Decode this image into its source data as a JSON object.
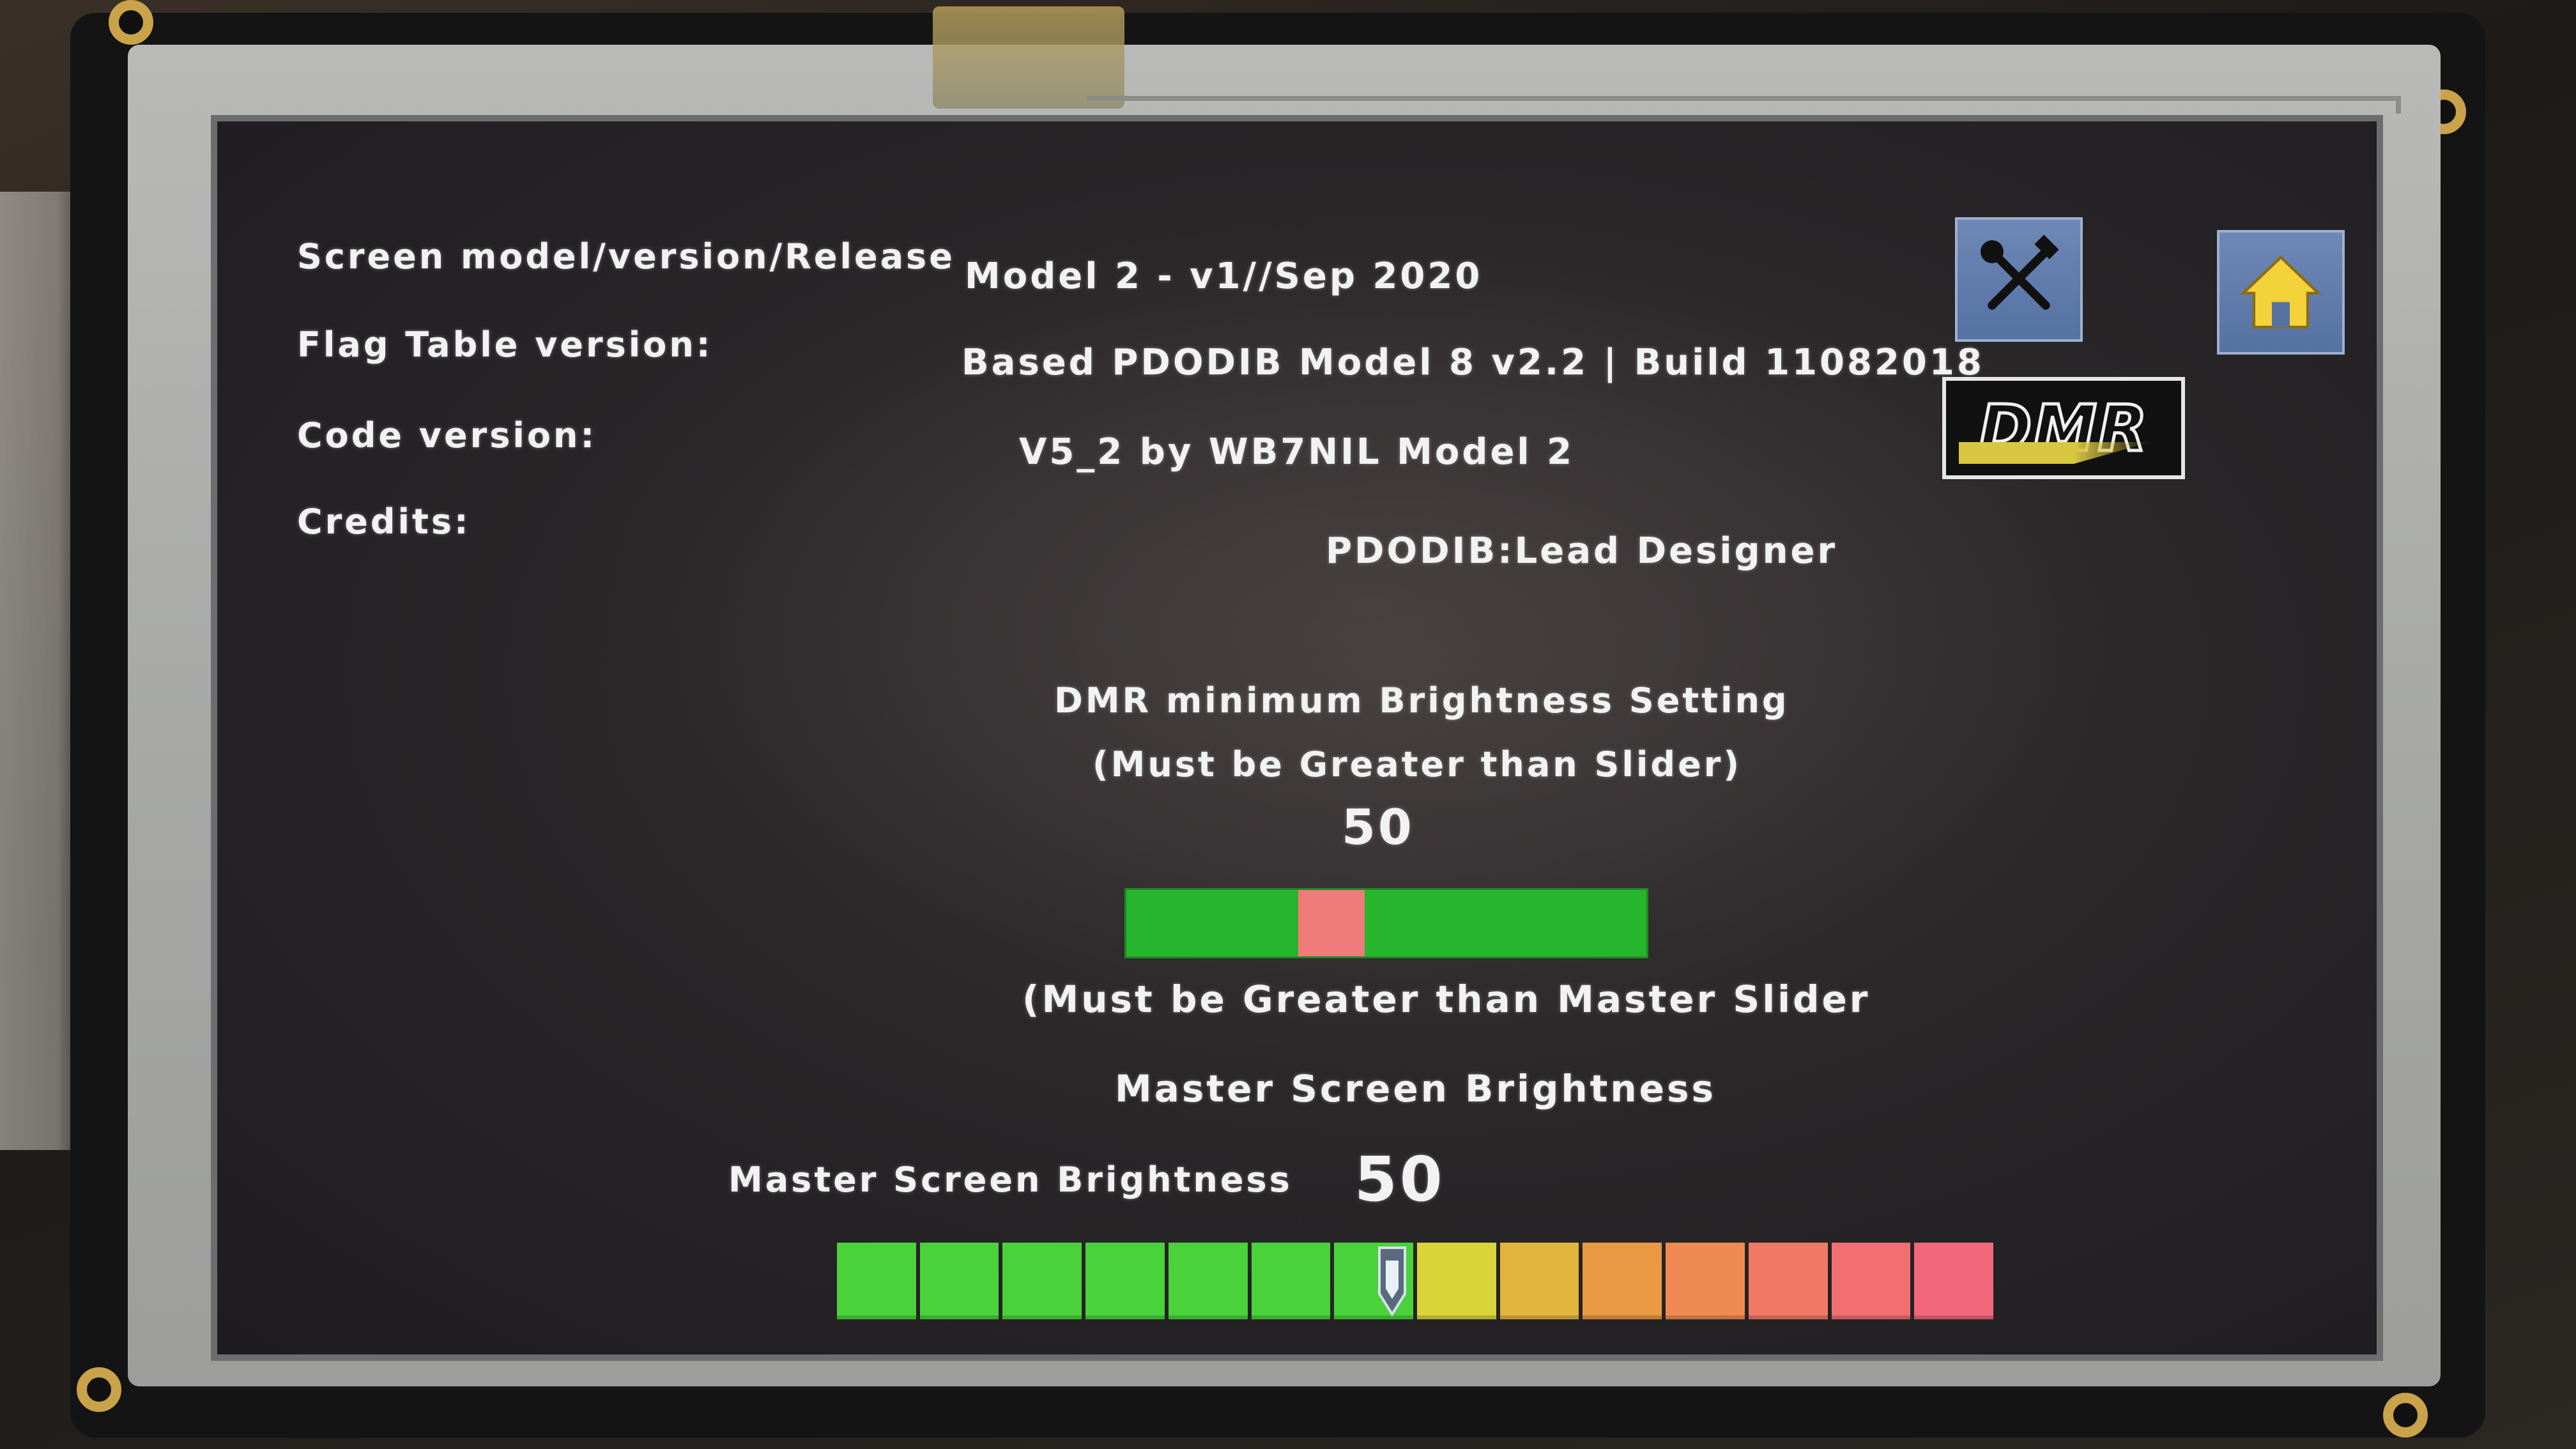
{
  "info": {
    "screen_model_label": "Screen model/version/Release",
    "screen_model_value": "Model 2 - v1//Sep 2020",
    "flag_table_label": "Flag Table version:",
    "flag_table_value": "Based PDODIB Model 8 v2.2 | Build 11082018",
    "code_version_label": "Code version:",
    "code_version_value": "V5_2 by WB7NIL Model 2",
    "credits_label": "Credits:",
    "credits_value": "PDODIB:Lead Designer"
  },
  "buttons": {
    "tools_icon": "tools-icon",
    "home_icon": "home-icon",
    "logo_text": "DMR"
  },
  "dmr_brightness": {
    "title": "DMR minimum Brightness Setting",
    "note_top": "(Must be Greater than Slider)",
    "value": "50",
    "note_bottom": "(Must be Greater than Master Slider",
    "marker_fraction": 0.33
  },
  "master_brightness": {
    "section_title": "Master Screen Brightness",
    "slider_label": "Master Screen Brightness",
    "value": "50",
    "level_fraction": 0.48,
    "segment_colors": [
      "#49d23a",
      "#49d23a",
      "#49d23a",
      "#49d23a",
      "#49d23a",
      "#49d23a",
      "#49d23a",
      "#d8d43a",
      "#e2b53c",
      "#ea9a42",
      "#ef8a52",
      "#f07a66",
      "#f16f72",
      "#f2687a"
    ]
  },
  "colors": {
    "button_blue": "#5a77a8",
    "slider_green": "#27b52e",
    "slider_marker": "#ef7b7a",
    "home_yellow": "#f3d23a"
  }
}
